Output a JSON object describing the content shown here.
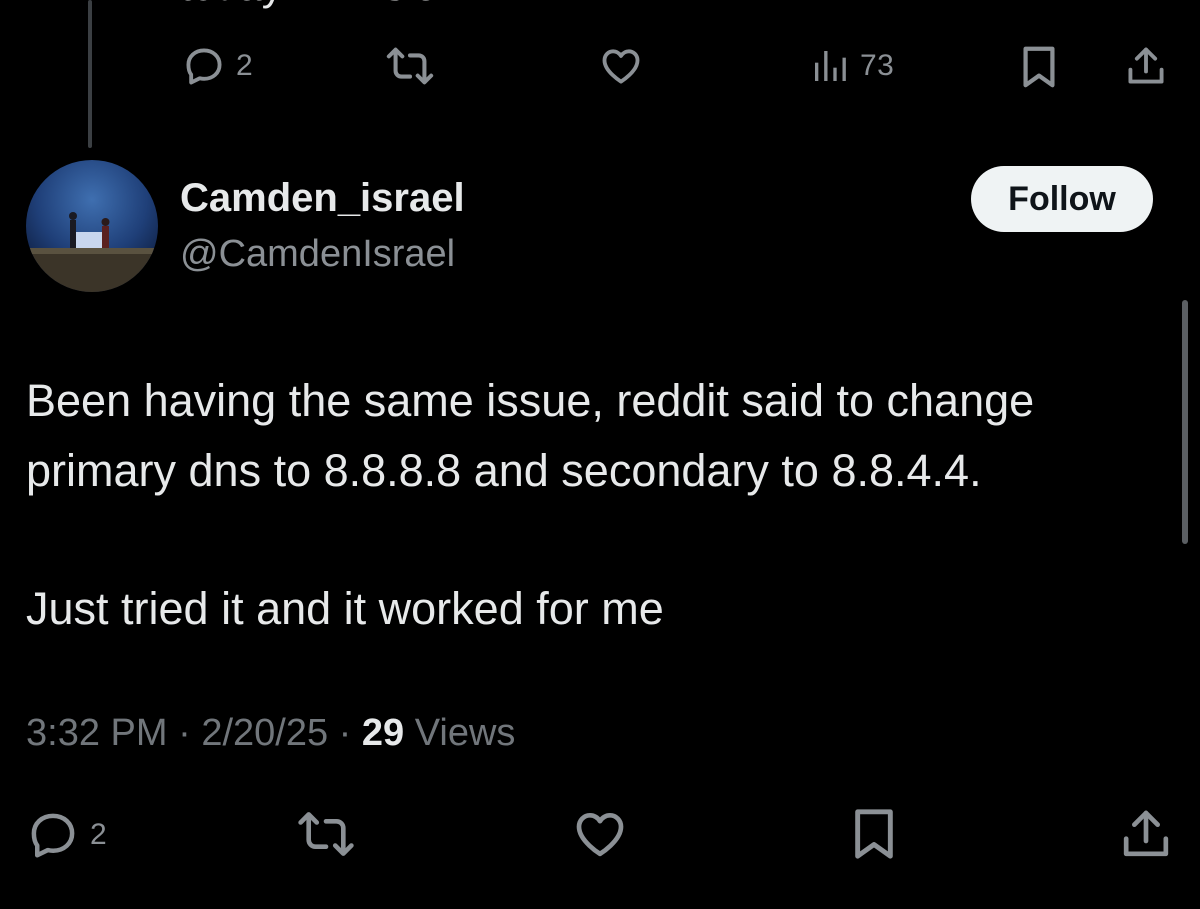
{
  "previous_tweet": {
    "text_cutoff": "today? I'm sick.",
    "actions": {
      "reply_count": "2",
      "views_count": "73"
    }
  },
  "tweet": {
    "author": {
      "display_name": "Camden_israel",
      "handle": "@CamdenIsrael"
    },
    "follow_label": "Follow",
    "body": {
      "paragraph_1": "Been having the same issue, reddit said to change primary dns to 8.8.8.8 and secondary to 8.8.4.4.",
      "paragraph_2": "Just tried it and it worked for me"
    },
    "meta": {
      "time": "3:32 PM",
      "separator": "·",
      "date": "2/20/25",
      "views_count": "29",
      "views_label": "Views"
    },
    "actions": {
      "reply_count": "2"
    }
  },
  "icons": [
    "reply-icon",
    "retweet-icon",
    "like-icon",
    "analytics-icon",
    "bookmark-icon",
    "share-icon"
  ],
  "colors": {
    "background": "#000000",
    "primary_text": "#e7e9ea",
    "secondary_text": "#71767b",
    "follow_button_bg": "#eff3f4"
  }
}
